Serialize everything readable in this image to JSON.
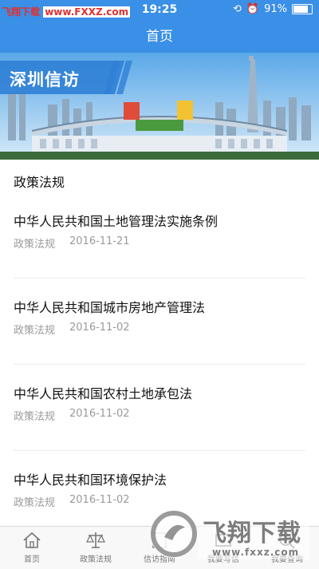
{
  "status": {
    "time": "19:25",
    "battery": "91%",
    "battery_level": 0.91
  },
  "watermark_top": {
    "brand": "飞翔下载",
    "url": "www.FXXZ.com"
  },
  "nav": {
    "title": "首页"
  },
  "banner": {
    "label": "深圳信访"
  },
  "section": {
    "title": "政策法规"
  },
  "articles": [
    {
      "title": "中华人民共和国土地管理法实施条例",
      "category": "政策法规",
      "date": "2016-11-21"
    },
    {
      "title": "中华人民共和国城市房地产管理法",
      "category": "政策法规",
      "date": "2016-11-02"
    },
    {
      "title": "中华人民共和国农村土地承包法",
      "category": "政策法规",
      "date": "2016-11-02"
    },
    {
      "title": "中华人民共和国环境保护法",
      "category": "政策法规",
      "date": "2016-11-02"
    }
  ],
  "tabs": [
    {
      "label": "首页",
      "icon": "home-icon"
    },
    {
      "label": "政策法规",
      "icon": "scale-icon"
    },
    {
      "label": "信访指南",
      "icon": "guide-icon"
    },
    {
      "label": "我要写信",
      "icon": "write-icon"
    },
    {
      "label": "我要查询",
      "icon": "query-icon"
    }
  ],
  "watermark_logo": {
    "brand": "飞翔下载",
    "url": "www.fxxz.com"
  }
}
